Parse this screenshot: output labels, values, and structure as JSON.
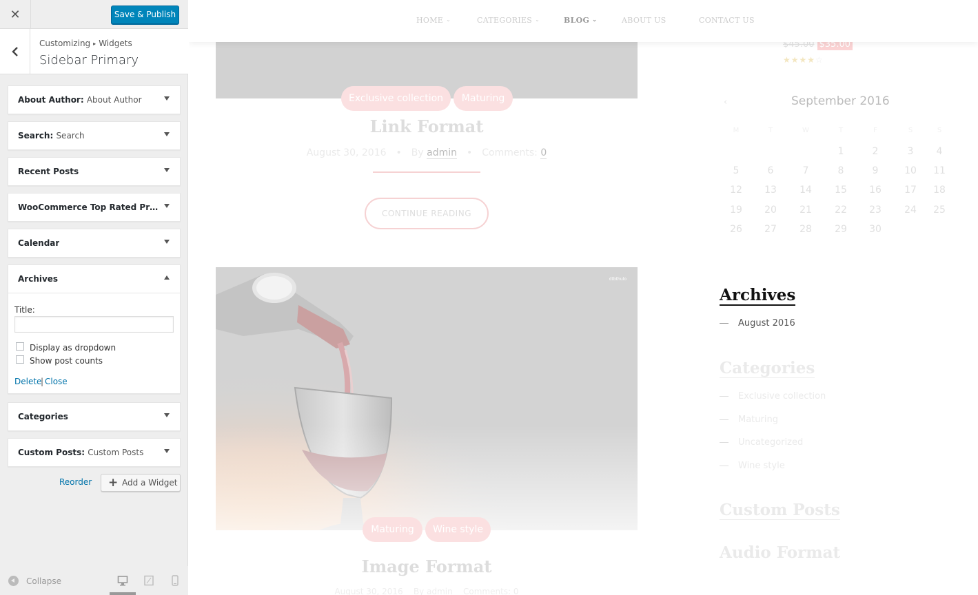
{
  "customizer": {
    "save_label": "Save & Publish",
    "close_glyph": "✕",
    "breadcrumb": {
      "root": "Customizing",
      "sep": "▸",
      "current": "Widgets"
    },
    "section_title": "Sidebar Primary",
    "widgets": [
      {
        "title": "About Author",
        "subtitle": "About Author",
        "expanded": false
      },
      {
        "title": "Search",
        "subtitle": "Search",
        "expanded": false
      },
      {
        "title": "Recent Posts",
        "subtitle": "",
        "expanded": false
      },
      {
        "title": "WooCommerce Top Rated Prod...",
        "subtitle": "",
        "expanded": false
      },
      {
        "title": "Calendar",
        "subtitle": "",
        "expanded": false
      },
      {
        "title": "Archives",
        "subtitle": "",
        "expanded": true
      },
      {
        "title": "Categories",
        "subtitle": "",
        "expanded": false
      },
      {
        "title": "Custom Posts",
        "subtitle": "Custom Posts",
        "expanded": false
      }
    ],
    "archives_form": {
      "title_label": "Title:",
      "title_value": "",
      "dropdown_label": "Display as dropdown",
      "dropdown_checked": false,
      "counts_label": "Show post counts",
      "counts_checked": false,
      "delete_label": "Delete",
      "pipe": "|",
      "close_label": "Close"
    },
    "reorder_label": "Reorder",
    "add_widget_label": "Add a Widget",
    "add_widget_glyph": "+",
    "collapse_label": "Collapse",
    "devices": [
      "desktop-icon",
      "tablet-icon",
      "mobile-icon"
    ]
  },
  "preview": {
    "nav": {
      "items": [
        {
          "label": "HOME",
          "chevron": "⌄"
        },
        {
          "label": "CATEGORIES",
          "chevron": "⌄"
        },
        {
          "label": "BLOG",
          "chevron": "⌄"
        },
        {
          "label": "ABOUT US",
          "chevron": ""
        },
        {
          "label": "CONTACT US",
          "chevron": ""
        }
      ]
    },
    "post1": {
      "tags": [
        "Exclusive collection",
        "Maturing"
      ],
      "title": "Link Format",
      "date": "August 30, 2016",
      "by": "By",
      "author": "admin",
      "comments_label": "Comments:",
      "comments_count": "0",
      "dot": "•",
      "continue_label": "CONTINUE READING"
    },
    "post2": {
      "tags": [
        "Maturing",
        "Wine style"
      ],
      "title": "Image Format",
      "date": "August 30, 2016",
      "by": "By",
      "author": "admin",
      "comments_label": "Comments:",
      "comments_count": "0",
      "watermark": "dtbthulo"
    },
    "product": {
      "old_price": "$45.00",
      "new_price": "$35.00",
      "rating": 4,
      "max_rating": 5
    },
    "calendar": {
      "prev": "‹",
      "caption": "September 2016",
      "day_names": [
        "M",
        "T",
        "W",
        "T",
        "F",
        "S",
        "S"
      ],
      "weeks": [
        [
          "",
          "",
          "",
          "1",
          "2",
          "3",
          "4"
        ],
        [
          "5",
          "6",
          "7",
          "8",
          "9",
          "10",
          "11"
        ],
        [
          "12",
          "13",
          "14",
          "15",
          "16",
          "17",
          "18"
        ],
        [
          "19",
          "20",
          "21",
          "22",
          "23",
          "24",
          "25"
        ],
        [
          "26",
          "27",
          "28",
          "29",
          "30",
          "",
          ""
        ]
      ]
    },
    "archives": {
      "title": "Archives",
      "items": [
        "August 2016"
      ]
    },
    "categories": {
      "title": "Categories",
      "items": [
        "Exclusive collection",
        "Maturing",
        "Uncategorized",
        "Wine style"
      ]
    },
    "custom_posts": {
      "title": "Custom Posts"
    },
    "audio_format": {
      "title": "Audio Format"
    },
    "colors": {
      "accent_blue": "#0085ba",
      "pink": "#fbe0e1",
      "link": "#0073aa"
    }
  }
}
